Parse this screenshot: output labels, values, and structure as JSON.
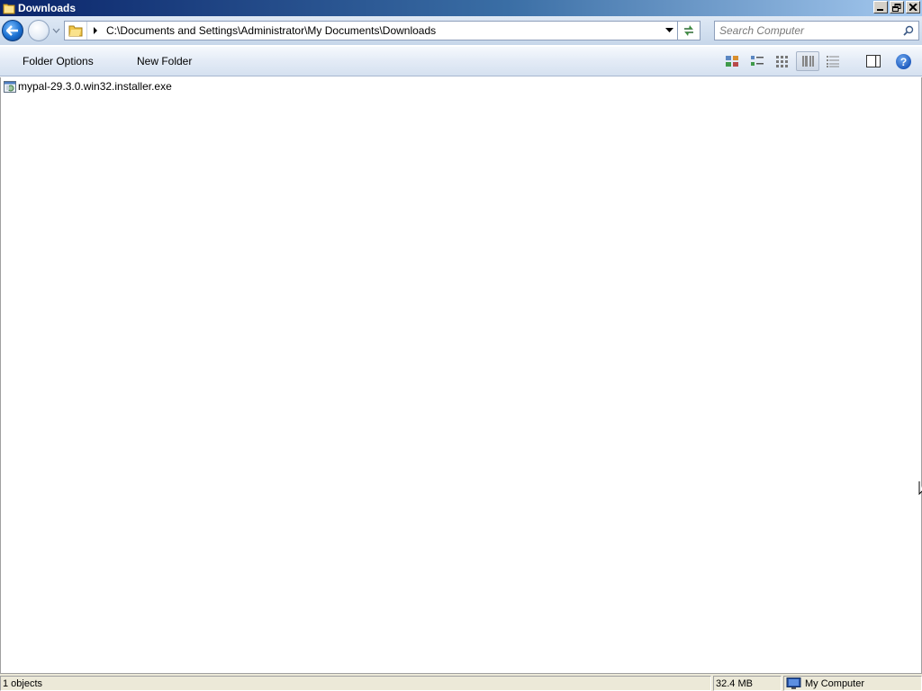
{
  "window": {
    "title": "Downloads",
    "icon": "folder-icon",
    "controls": [
      "minimize",
      "restore",
      "close"
    ]
  },
  "navigation": {
    "back_icon": "back-arrow-icon",
    "forward_icon": "forward-arrow-icon",
    "address_path": "C:\\Documents and Settings\\Administrator\\My Documents\\Downloads",
    "search_placeholder": "Search Computer"
  },
  "toolbar": {
    "folder_options_label": "Folder Options",
    "new_folder_label": "New Folder",
    "view_buttons": [
      "large-icons-view-icon",
      "tiles-view-icon",
      "small-icons-view-icon",
      "list-view-icon",
      "details-view-icon"
    ],
    "active_view": "list-view-icon",
    "preview_pane_icon": "preview-pane-icon",
    "help_label": "?"
  },
  "files": [
    {
      "name": "mypal-29.3.0.win32.installer.exe",
      "icon": "exe-installer-icon"
    }
  ],
  "statusbar": {
    "objects": "1 objects",
    "size": "32.4 MB",
    "zone": "My Computer"
  },
  "colors": {
    "titlebar_start": "#0a246a",
    "titlebar_end": "#a6caf0",
    "toolbar_bg": "#dfe9f5",
    "statusbar_bg": "#ece9d8"
  }
}
